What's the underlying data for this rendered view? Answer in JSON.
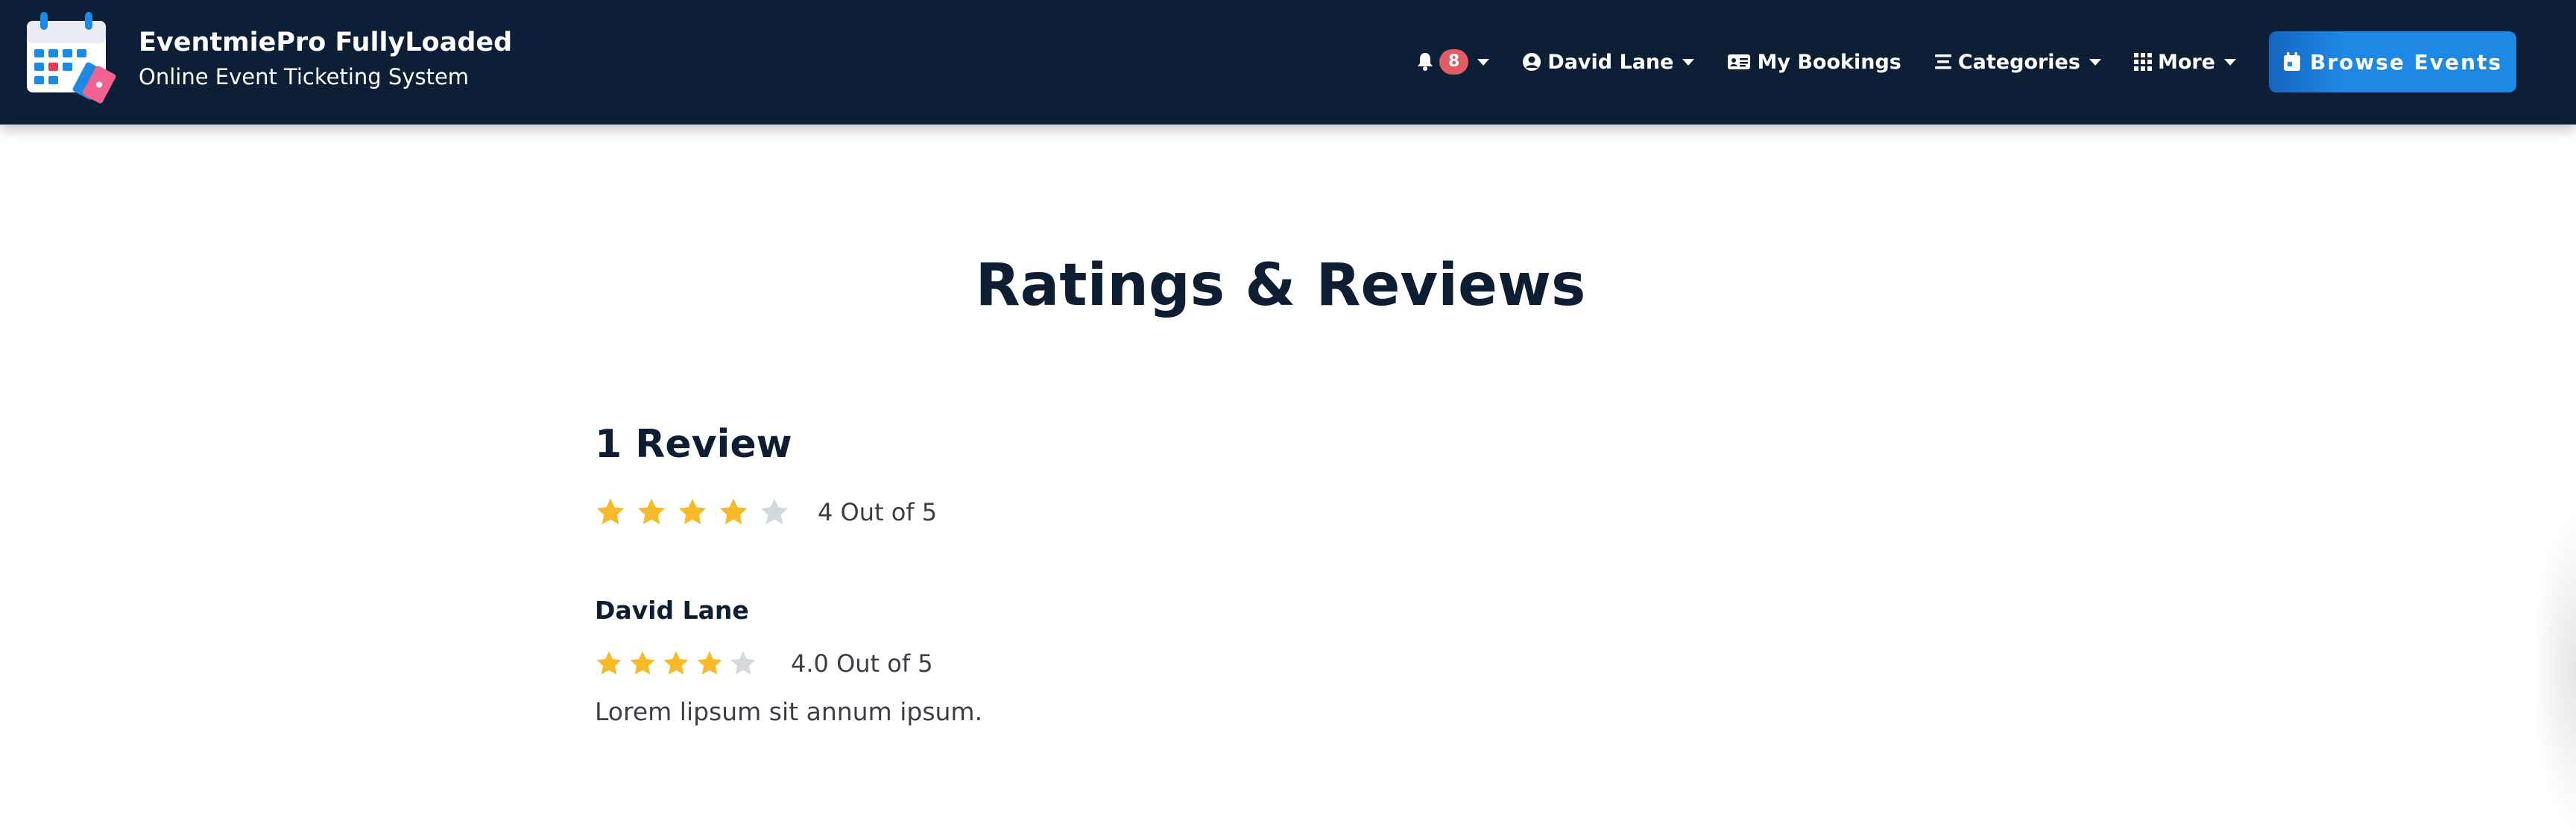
{
  "app": {
    "name": "EventmiePro FullyLoaded",
    "tagline": "Online Event Ticketing System"
  },
  "nav": {
    "notifications": {
      "icon": "bell-icon",
      "count": "8"
    },
    "user": {
      "icon": "user-circle-icon",
      "label": "David Lane"
    },
    "bookings": {
      "icon": "id-card-icon",
      "label": "My Bookings"
    },
    "categories": {
      "icon": "list-icon",
      "label": "Categories"
    },
    "more": {
      "icon": "grid-icon",
      "label": "More"
    },
    "browse": {
      "icon": "calendar-icon",
      "label": "Browse Events"
    }
  },
  "page": {
    "title": "Ratings & Reviews"
  },
  "summary": {
    "count_label": "1 Review",
    "stars": 4,
    "max_stars": 5,
    "rating_text": "4 Out of 5"
  },
  "reviews": [
    {
      "author": "David Lane",
      "stars": 4,
      "max_stars": 5,
      "rating_text": "4.0 Out of 5",
      "text": "Lorem lipsum sit annum ipsum."
    }
  ],
  "colors": {
    "navbar": "#0c1f36",
    "accent": "#1e88e5",
    "star_filled": "#f7b928",
    "star_empty": "#d3d8de",
    "badge": "#e05d66",
    "heading": "#0d1e33"
  }
}
